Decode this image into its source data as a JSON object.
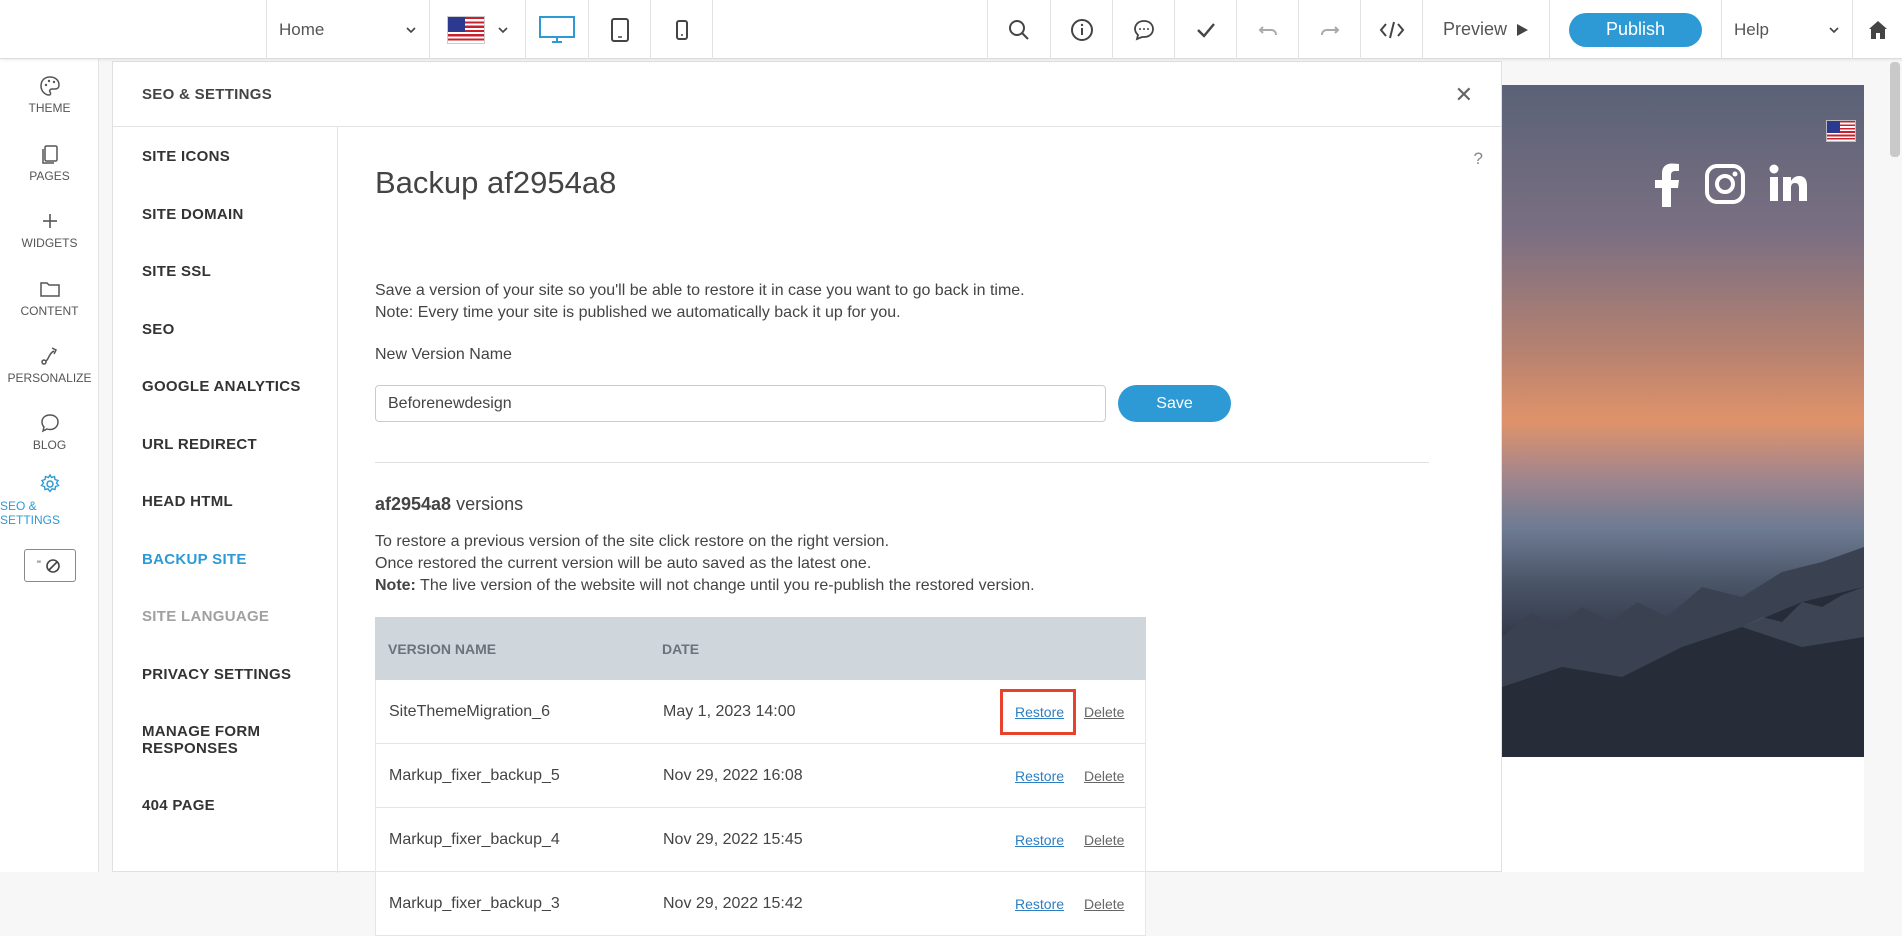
{
  "toolbar": {
    "page_select": "Home",
    "preview_label": "Preview",
    "publish_label": "Publish",
    "help_label": "Help"
  },
  "sidebar": {
    "items": [
      {
        "label": "THEME",
        "icon": "palette-icon"
      },
      {
        "label": "PAGES",
        "icon": "pages-icon"
      },
      {
        "label": "WIDGETS",
        "icon": "plus-icon"
      },
      {
        "label": "CONTENT",
        "icon": "folder-icon"
      },
      {
        "label": "PERSONALIZE",
        "icon": "personalize-icon"
      },
      {
        "label": "BLOG",
        "icon": "chat-bubble-icon"
      },
      {
        "label": "SEO & SETTINGS",
        "icon": "gear-icon",
        "active": true
      }
    ]
  },
  "panel": {
    "header": "SEO & SETTINGS",
    "nav": [
      {
        "label": "SITE ICONS"
      },
      {
        "label": "SITE DOMAIN"
      },
      {
        "label": "SITE SSL"
      },
      {
        "label": "SEO"
      },
      {
        "label": "GOOGLE ANALYTICS"
      },
      {
        "label": "URL REDIRECT"
      },
      {
        "label": "HEAD HTML"
      },
      {
        "label": "BACKUP SITE",
        "active": true
      },
      {
        "label": "SITE LANGUAGE",
        "disabled": true
      },
      {
        "label": "PRIVACY SETTINGS"
      },
      {
        "label": "MANAGE FORM",
        "label2": "RESPONSES"
      },
      {
        "label": "404 PAGE"
      }
    ]
  },
  "backup": {
    "help": "?",
    "title": "Backup af2954a8",
    "desc_line1": "Save a version of your site so you'll be able to restore it in case you want to go back in time.",
    "desc_line2": "Note: Every time your site is published we automatically back it up for you.",
    "new_version_label": "New Version Name",
    "new_version_value": "Beforenewdesign",
    "save_label": "Save",
    "versions_site": "af2954a8",
    "versions_word": " versions",
    "restore_line1": "To restore a previous version of the site click restore on the right version.",
    "restore_line2": "Once restored the current version will be auto saved as the latest one.",
    "note_label": "Note:",
    "note_text": " The live version of the website will not change until you re-publish the restored version.",
    "table": {
      "headers": [
        "VERSION NAME",
        "DATE"
      ],
      "rows": [
        {
          "name": "SiteThemeMigration_6",
          "date": "May 1, 2023 14:00",
          "restore": "Restore",
          "delete": "Delete"
        },
        {
          "name": "Markup_fixer_backup_5",
          "date": "Nov 29, 2022 16:08",
          "restore": "Restore",
          "delete": "Delete"
        },
        {
          "name": "Markup_fixer_backup_4",
          "date": "Nov 29, 2022 15:45",
          "restore": "Restore",
          "delete": "Delete"
        },
        {
          "name": "Markup_fixer_backup_3",
          "date": "Nov 29, 2022 15:42",
          "restore": "Restore",
          "delete": "Delete"
        }
      ]
    }
  },
  "colors": {
    "accent": "#2d9ad6",
    "highlight": "#e8412c"
  }
}
